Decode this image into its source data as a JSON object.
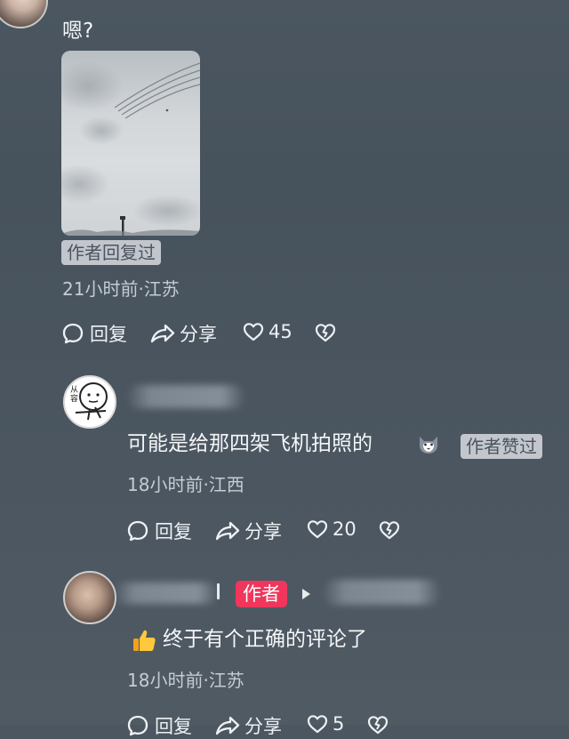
{
  "comments": [
    {
      "text": "嗯?",
      "badge": "作者回复过",
      "meta": "21小时前·江苏",
      "actions": {
        "reply": "回复",
        "share": "分享",
        "likes": "45"
      }
    },
    {
      "text": "可能是给那四架飞机拍照的",
      "badge": "作者赞过",
      "meta": "18小时前·江西",
      "avatar_text": "从容",
      "actions": {
        "reply": "回复",
        "share": "分享",
        "likes": "20"
      }
    },
    {
      "author_tag": "作者",
      "text": "终于有个正确的评论了",
      "meta": "18小时前·江苏",
      "actions": {
        "reply": "回复",
        "share": "分享",
        "likes": "5"
      }
    }
  ],
  "colors": {
    "author_tag_bg": "#f0365c",
    "badge_bg": "#e1e4e8",
    "text_primary": "#f4f6f8",
    "text_meta": "#c5ccd2"
  },
  "icons": [
    "reply-bubble-icon",
    "share-arrow-icon",
    "heart-icon",
    "broken-heart-icon",
    "thumbs-up-emoji",
    "cat-emoji",
    "play-triangle-icon"
  ]
}
